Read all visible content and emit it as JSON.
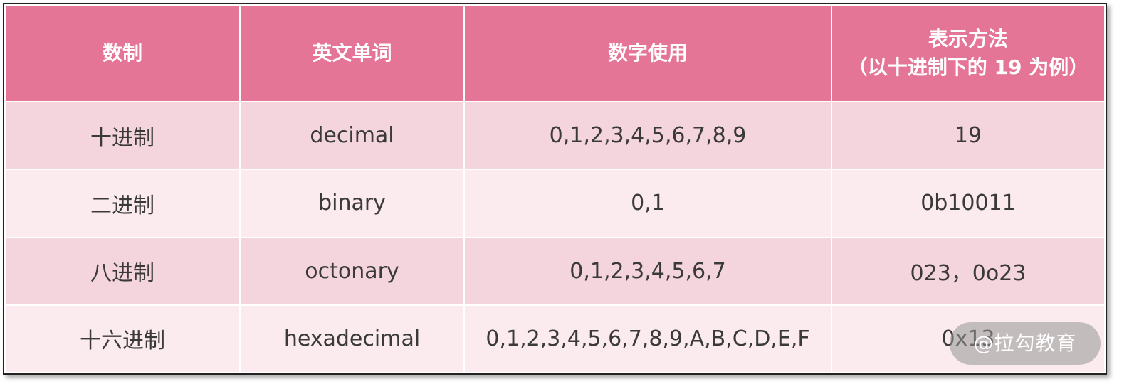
{
  "table": {
    "headers": [
      "数制",
      "英文单词",
      "数字使用",
      "表示方法",
      "（以十进制下的 19 为例）"
    ],
    "rows": [
      {
        "system": "十进制",
        "english": "decimal",
        "digits": "0,1,2,3,4,5,6,7,8,9",
        "notation": "19"
      },
      {
        "system": "二进制",
        "english": "binary",
        "digits": "0,1",
        "notation": "0b10011"
      },
      {
        "system": "八进制",
        "english": "octonary",
        "digits": "0,1,2,3,4,5,6,7",
        "notation": "023，0o23"
      },
      {
        "system": "十六进制",
        "english": "hexadecimal",
        "digits": "0,1,2,3,4,5,6,7,8,9,A,B,C,D,E,F",
        "notation": "0x13"
      }
    ]
  },
  "watermark": {
    "text": "@拉勾教育"
  },
  "colors": {
    "header_bg": "#e57597",
    "row_odd_bg": "#f5d5dd",
    "row_even_bg": "#fbeaee",
    "text": "#3a3a3a"
  }
}
